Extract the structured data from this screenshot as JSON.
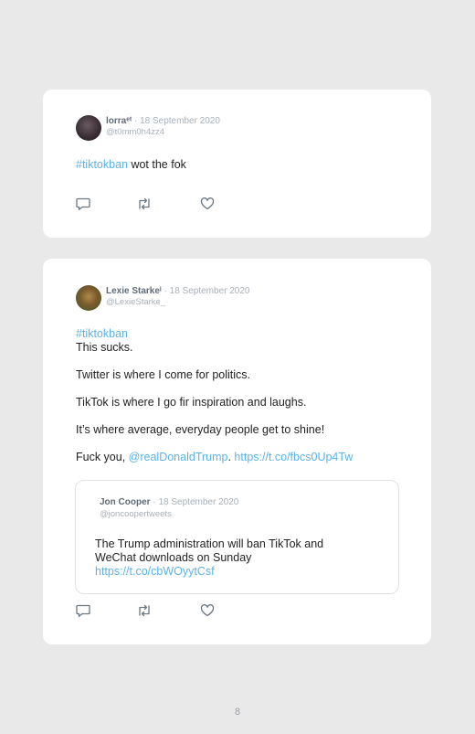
{
  "tweet1": {
    "name": "lorraᵉᵗ",
    "sep": "·",
    "date": "18 September 2020",
    "handle": "@t0mm0h4zz4",
    "hashtag": "#tiktokban",
    "text": " wot the fok"
  },
  "tweet2": {
    "name": "Lexie Starkeᴵ",
    "sep": "·",
    "date": "18 September 2020",
    "handle": "@LexieStarke_",
    "hashtag": "#tiktokban",
    "line1": "This sucks.",
    "line2": "Twitter is where I come for politics.",
    "line3": "TikTok is where I go fir inspiration and laughs.",
    "line4": "It’s where average, everyday people get to shine!",
    "line5_prefix": "Fuck you, ",
    "mention": "@realDonaldTrump",
    "line5_mid": ". ",
    "link": "https://t.co/fbcs0Up4Tw",
    "quote": {
      "name": "Jon Cooper",
      "sep": "·",
      "date": "18 September 2020",
      "handle": "@joncoopertweets",
      "line1": "The Trump administration will ban TikTok and",
      "line2": "WeChat downloads on Sunday",
      "link": "https://t.co/cbWOyytCsf"
    }
  },
  "icons": {
    "reply": "reply-icon",
    "retweet": "retweet-icon",
    "like": "heart-icon"
  },
  "colors": {
    "link": "#5bb4e5",
    "name": "#5f6b78",
    "meta": "#a8b0b8",
    "background": "#e9e9e9"
  },
  "page_number": "8"
}
